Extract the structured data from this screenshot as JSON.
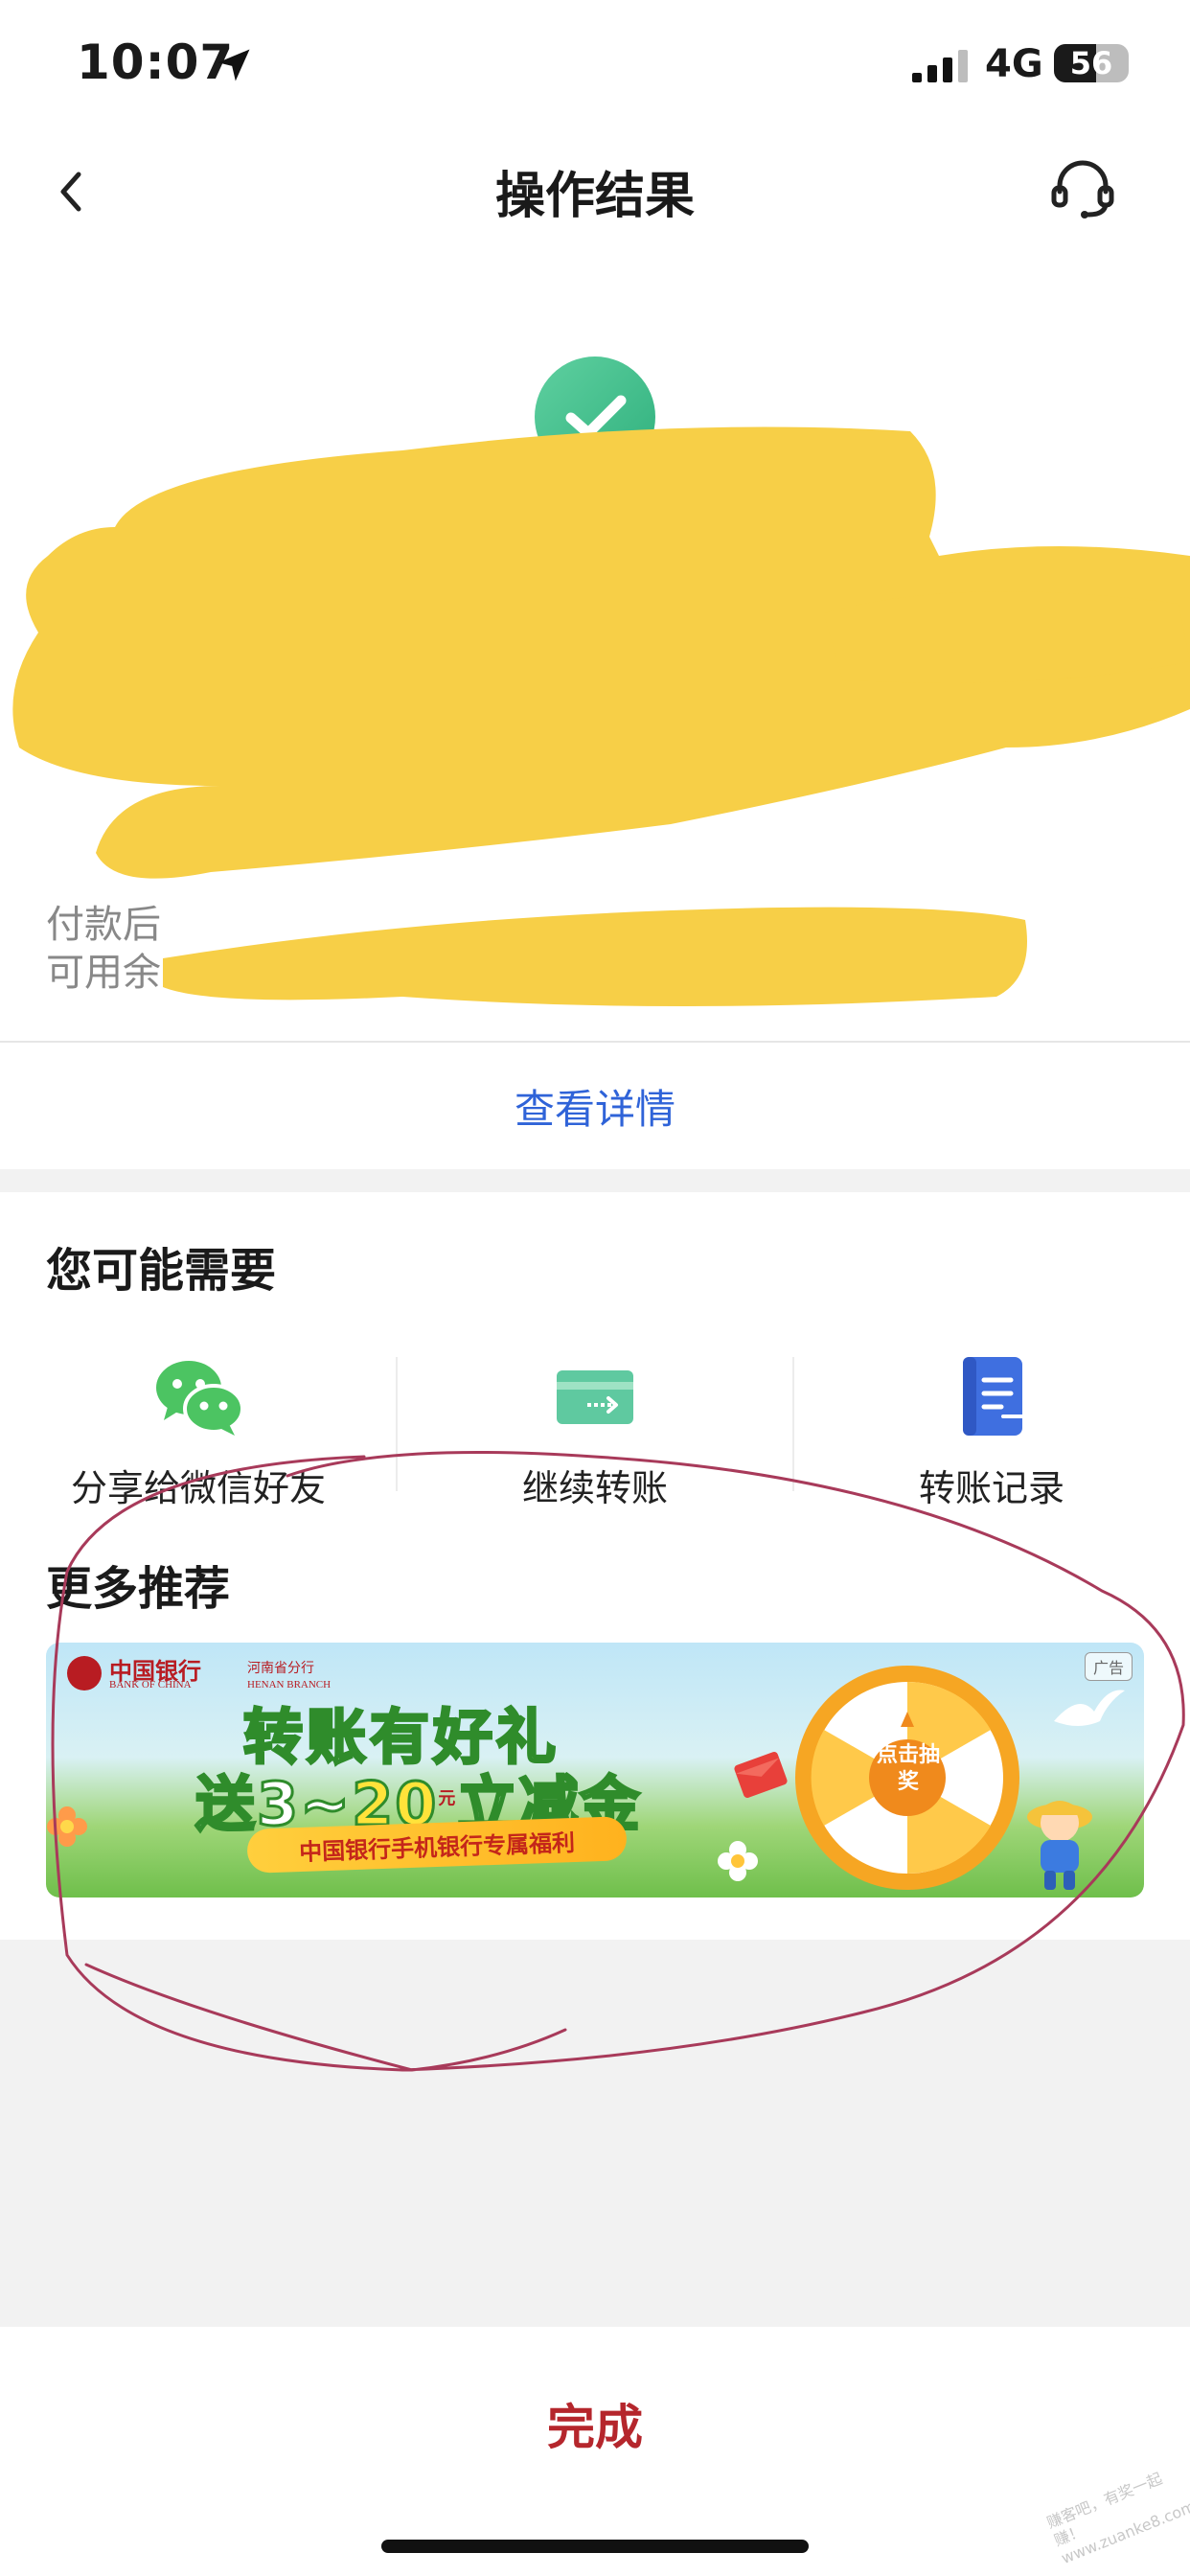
{
  "status_bar": {
    "time": "10:07",
    "network": "4G",
    "battery_text": "56",
    "battery_level": 0.56,
    "icons": [
      "location-arrow-icon",
      "signal-icon"
    ]
  },
  "nav": {
    "title": "操作结果",
    "back_icon": "chevron-left-icon",
    "service_icon": "headset-icon"
  },
  "result": {
    "status_icon": "check-circle-icon",
    "status_color": "#3dbb8a",
    "redaction_color": "#f7cf47",
    "balance_after_label": "付款后",
    "available_label": "可用余"
  },
  "detail_link": "查看详情",
  "recommend": {
    "title": "您可能需要",
    "actions": [
      {
        "label": "分享给微信好友",
        "icon": "wechat-icon"
      },
      {
        "label": "继续转账",
        "icon": "transfer-card-icon"
      },
      {
        "label": "转账记录",
        "icon": "record-book-icon"
      }
    ],
    "more_title": "更多推荐",
    "banner": {
      "bank_name_cn": "中国银行",
      "bank_name_en": "BANK OF CHINA",
      "branch_cn": "河南省分行",
      "branch_en": "HENAN BRANCH",
      "ad_badge": "广告",
      "headline": "转账有好礼",
      "line2_prefix": "送3~",
      "line2_amount": "20",
      "line2_unit": "元",
      "line2_suffix": "立减金",
      "ribbon": "中国银行手机银行专属福利",
      "wheel_center": "点击抽奖"
    }
  },
  "done_button": "完成",
  "watermark": "赚客吧，有奖一起赚！ www.zuanke8.com",
  "annotation_color": "#a83a5a"
}
